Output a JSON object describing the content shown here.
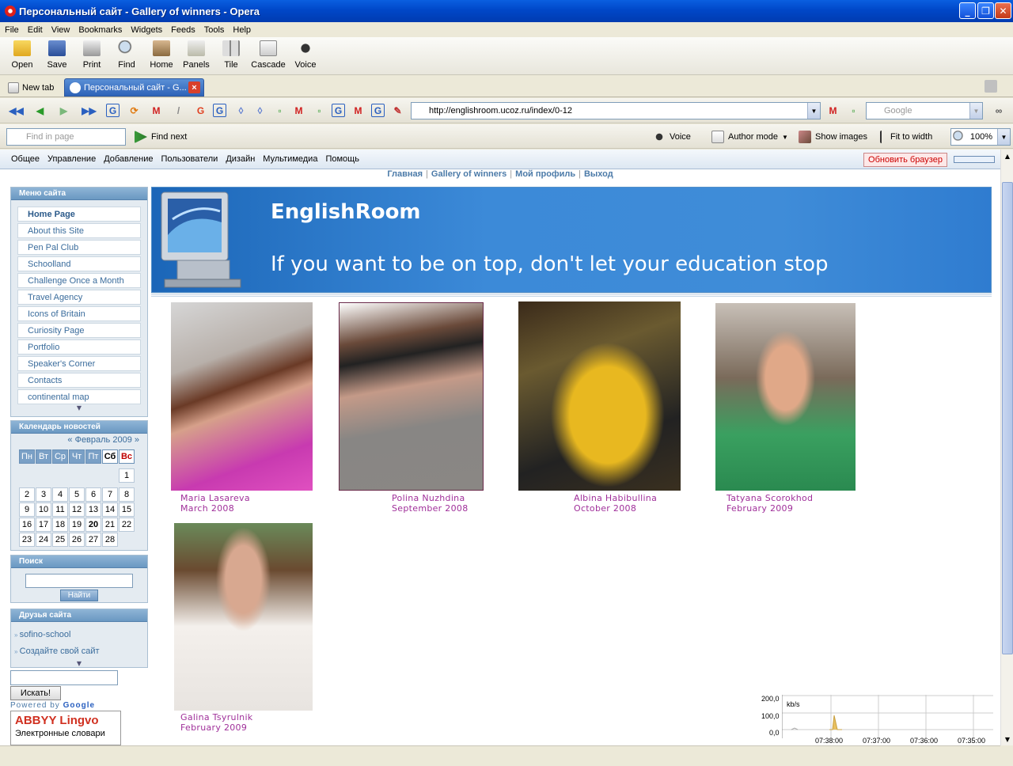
{
  "window": {
    "title": "Персональный сайт - Gallery of winners - Opera",
    "controls": [
      "_",
      "❐",
      "✕"
    ]
  },
  "menu": [
    "File",
    "Edit",
    "View",
    "Bookmarks",
    "Widgets",
    "Feeds",
    "Tools",
    "Help"
  ],
  "toolbar": [
    {
      "label": "Open",
      "icon": "folder-icon"
    },
    {
      "label": "Save",
      "icon": "save-icon"
    },
    {
      "label": "Print",
      "icon": "print-icon"
    },
    {
      "label": "Find",
      "icon": "find-icon"
    },
    {
      "label": "Home",
      "icon": "home-icon"
    },
    {
      "label": "Panels",
      "icon": "panels-icon"
    },
    {
      "label": "Tile",
      "icon": "tile-icon"
    },
    {
      "label": "Cascade",
      "icon": "cascade-icon"
    },
    {
      "label": "Voice",
      "icon": "voice-icon"
    }
  ],
  "tabs": {
    "new_tab": "New tab",
    "active": "Персональный сайт - G..."
  },
  "address": {
    "url": "http://englishroom.ucoz.ru/index/0-12",
    "search_placeholder": "Google"
  },
  "findbar": {
    "placeholder": "Find in page",
    "find_next": "Find next",
    "voice": "Voice",
    "author_mode": "Author mode",
    "show_images": "Show images",
    "fit_to_width": "Fit to width",
    "zoom": "100%"
  },
  "ucoz_panel": {
    "items": [
      "Общее",
      "Управление",
      "Добавление",
      "Пользователи",
      "Дизайн",
      "Мультимедиа",
      "Помощь"
    ],
    "refresh_button": "Обновить браузер"
  },
  "site": {
    "top_links": [
      "Главная",
      "Gallery of winners",
      "Мой профиль",
      "Выход"
    ],
    "banner_title": "EnglishRoom",
    "banner_slogan": "If you want to be on top, don't let your education stop",
    "menu_header": "Меню сайта",
    "menu_items": [
      "Home Page",
      "About this Site",
      "Pen Pal Club",
      "Schoolland",
      "Challenge Once a Month",
      "Travel Agency",
      "Icons of Britain",
      "Curiosity Page",
      "Portfolio",
      "Speaker's Corner",
      "Contacts",
      "continental map"
    ],
    "calendar_header": "Календарь новостей",
    "calendar_nav": "«  Февраль 2009  »",
    "weekdays": [
      "Пн",
      "Вт",
      "Ср",
      "Чт",
      "Пт",
      "Сб",
      "Вс"
    ],
    "weeks": [
      [
        "",
        "",
        "",
        "",
        "",
        "",
        "1"
      ],
      [
        "2",
        "3",
        "4",
        "5",
        "6",
        "7",
        "8"
      ],
      [
        "9",
        "10",
        "11",
        "12",
        "13",
        "14",
        "15"
      ],
      [
        "16",
        "17",
        "18",
        "19",
        "20",
        "21",
        "22"
      ],
      [
        "23",
        "24",
        "25",
        "26",
        "27",
        "28",
        ""
      ]
    ],
    "today": "20",
    "search_header": "Поиск",
    "search_button": "Найти",
    "friends_header": "Друзья сайта",
    "friends": [
      "sofino-school",
      "Создайте свой сайт"
    ],
    "google_button": "Искать!",
    "powered_by": "Powered by",
    "google_word": "Google",
    "lingvo_brand": "ABBYY Lingvo",
    "lingvo_sub": "Электронные словари"
  },
  "gallery": [
    {
      "name": "Maria Lasareva",
      "date": "March 2008"
    },
    {
      "name": "Polina Nuzhdina",
      "date": "September 2008"
    },
    {
      "name": "Albina Habibullina",
      "date": "October 2008"
    },
    {
      "name": "Tatyana Scorokhod",
      "date": "February 2009"
    },
    {
      "name": "Galina Tsyrulnik",
      "date": "February 2009"
    }
  ],
  "traffic_graph": {
    "unit": "kb/s",
    "y_ticks": [
      "200,0",
      "100,0",
      "0,0"
    ],
    "x_ticks": [
      "07:38:00",
      "07:37:00",
      "07:36:00",
      "07:35:00"
    ]
  },
  "colors": {
    "accent": "#0047c8",
    "caption": "#a0309a",
    "sunday": "#c00000"
  }
}
